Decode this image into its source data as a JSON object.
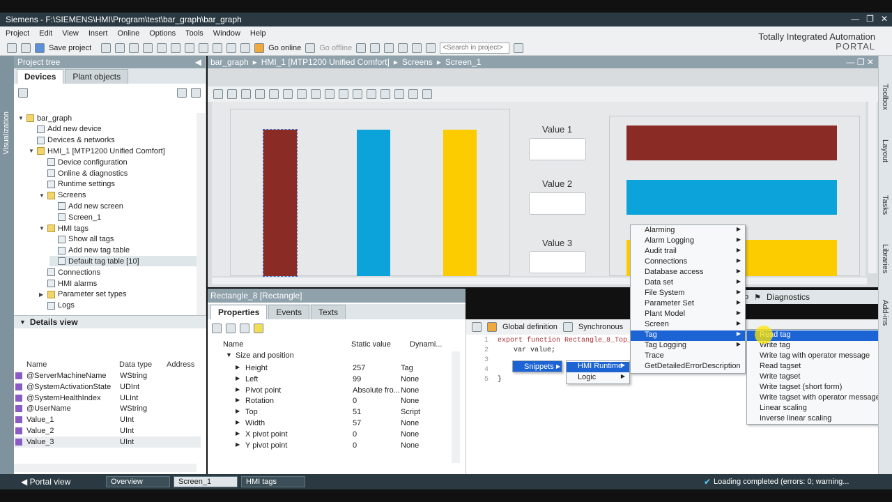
{
  "window": {
    "title": "Siemens  -  F:\\SIEMENS\\HMI\\Program\\test\\bar_graph\\bar_graph"
  },
  "menu": [
    "Project",
    "Edit",
    "View",
    "Insert",
    "Online",
    "Options",
    "Tools",
    "Window",
    "Help"
  ],
  "toolbar": {
    "save_label": "Save project",
    "go_online": "Go online",
    "go_offline": "Go offline",
    "search_placeholder": "<Search in project>"
  },
  "brand": {
    "line1": "Totally Integrated Automation",
    "line2": "PORTAL"
  },
  "left_strip": "Visualization",
  "project_tree": {
    "title": "Project tree",
    "tabs": [
      "Devices",
      "Plant objects"
    ],
    "items": [
      {
        "label": "bar_graph",
        "level": 0,
        "exp": "▼"
      },
      {
        "label": "Add new device",
        "level": 1,
        "exp": ""
      },
      {
        "label": "Devices & networks",
        "level": 1,
        "exp": ""
      },
      {
        "label": "HMI_1 [MTP1200 Unified Comfort]",
        "level": 1,
        "exp": "▼"
      },
      {
        "label": "Device configuration",
        "level": 2,
        "exp": ""
      },
      {
        "label": "Online & diagnostics",
        "level": 2,
        "exp": ""
      },
      {
        "label": "Runtime settings",
        "level": 2,
        "exp": ""
      },
      {
        "label": "Screens",
        "level": 2,
        "exp": "▼"
      },
      {
        "label": "Add new screen",
        "level": 3,
        "exp": ""
      },
      {
        "label": "Screen_1",
        "level": 3,
        "exp": ""
      },
      {
        "label": "HMI tags",
        "level": 2,
        "exp": "▼"
      },
      {
        "label": "Show all tags",
        "level": 3,
        "exp": ""
      },
      {
        "label": "Add new tag table",
        "level": 3,
        "exp": ""
      },
      {
        "label": "Default tag table [10]",
        "level": 3,
        "exp": ""
      },
      {
        "label": "Connections",
        "level": 2,
        "exp": ""
      },
      {
        "label": "HMI alarms",
        "level": 2,
        "exp": ""
      },
      {
        "label": "Parameter set types",
        "level": 2,
        "exp": "▶"
      },
      {
        "label": "Logs",
        "level": 2,
        "exp": ""
      }
    ]
  },
  "details": {
    "title": "Details view",
    "columns": [
      "Name",
      "Data type",
      "Address"
    ],
    "rows": [
      {
        "name": "@ServerMachineName",
        "type": "WString"
      },
      {
        "name": "@SystemActivationState",
        "type": "UDInt"
      },
      {
        "name": "@SystemHealthIndex",
        "type": "ULInt"
      },
      {
        "name": "@UserName",
        "type": "WString"
      },
      {
        "name": "Value_1",
        "type": "UInt"
      },
      {
        "name": "Value_2",
        "type": "UInt"
      },
      {
        "name": "Value_3",
        "type": "UInt"
      }
    ]
  },
  "editor": {
    "breadcrumb": [
      "bar_graph",
      "HMI_1 [MTP1200 Unified Comfort]",
      "Screens",
      "Screen_1"
    ],
    "value_labels": [
      "Value 1",
      "Value 2",
      "Value 3"
    ],
    "colors": {
      "red": "#8b2b26",
      "blue": "#0ba3d9",
      "yellow": "#fccc00"
    }
  },
  "properties": {
    "title": "Rectangle_8 [Rectangle]",
    "tabs": [
      "Properties",
      "Events",
      "Texts"
    ],
    "columns": [
      "Name",
      "Static value",
      "Dynami..."
    ],
    "group": "Size and position",
    "rows": [
      {
        "name": "Height",
        "value": "257",
        "dyn": "Tag"
      },
      {
        "name": "Left",
        "value": "99",
        "dyn": "None"
      },
      {
        "name": "Pivot point",
        "value": "Absolute fro...",
        "dyn": "None"
      },
      {
        "name": "Rotation",
        "value": "0",
        "dyn": "None"
      },
      {
        "name": "Top",
        "value": "51",
        "dyn": "Script"
      },
      {
        "name": "Width",
        "value": "57",
        "dyn": "None"
      },
      {
        "name": "X pivot point",
        "value": "0",
        "dyn": "None"
      },
      {
        "name": "Y pivot point",
        "value": "0",
        "dyn": "None"
      }
    ]
  },
  "script": {
    "toolbar": [
      "Global definition",
      "Synchronous"
    ],
    "line_numbers": [
      "1",
      "2",
      "3",
      "4",
      "5"
    ],
    "line1": "export function Rectangle_8_Top_T",
    "line2": "var value;",
    "line5": "}",
    "diagnostics": "Diagnostics",
    "lo": "o"
  },
  "snippets_menu": {
    "snippets": "Snippets",
    "hmi_runtime": "HMI Runtime",
    "logic": "Logic"
  },
  "context_menu": [
    "Alarming",
    "Alarm Logging",
    "Audit trail",
    "Connections",
    "Database access",
    "Data set",
    "File System",
    "Parameter Set",
    "Plant Model",
    "Screen",
    "Tag",
    "Tag Logging",
    "Trace",
    "GetDetailedErrorDescription"
  ],
  "tag_submenu": [
    "Read tag",
    "Write tag",
    "Write tag with operator message",
    "Read tagset",
    "Write tagset",
    "Write tagset (short form)",
    "Write tagset with operator message",
    "Linear scaling",
    "Inverse linear scaling"
  ],
  "right_strip": [
    "Toolbox",
    "Layout",
    "Tasks",
    "Libraries",
    "Add-ins"
  ],
  "statusbar": {
    "portal_view": "Portal view",
    "tabs": [
      "Overview",
      "Screen_1",
      "HMI tags"
    ],
    "status": "Loading completed (errors: 0; warning..."
  }
}
